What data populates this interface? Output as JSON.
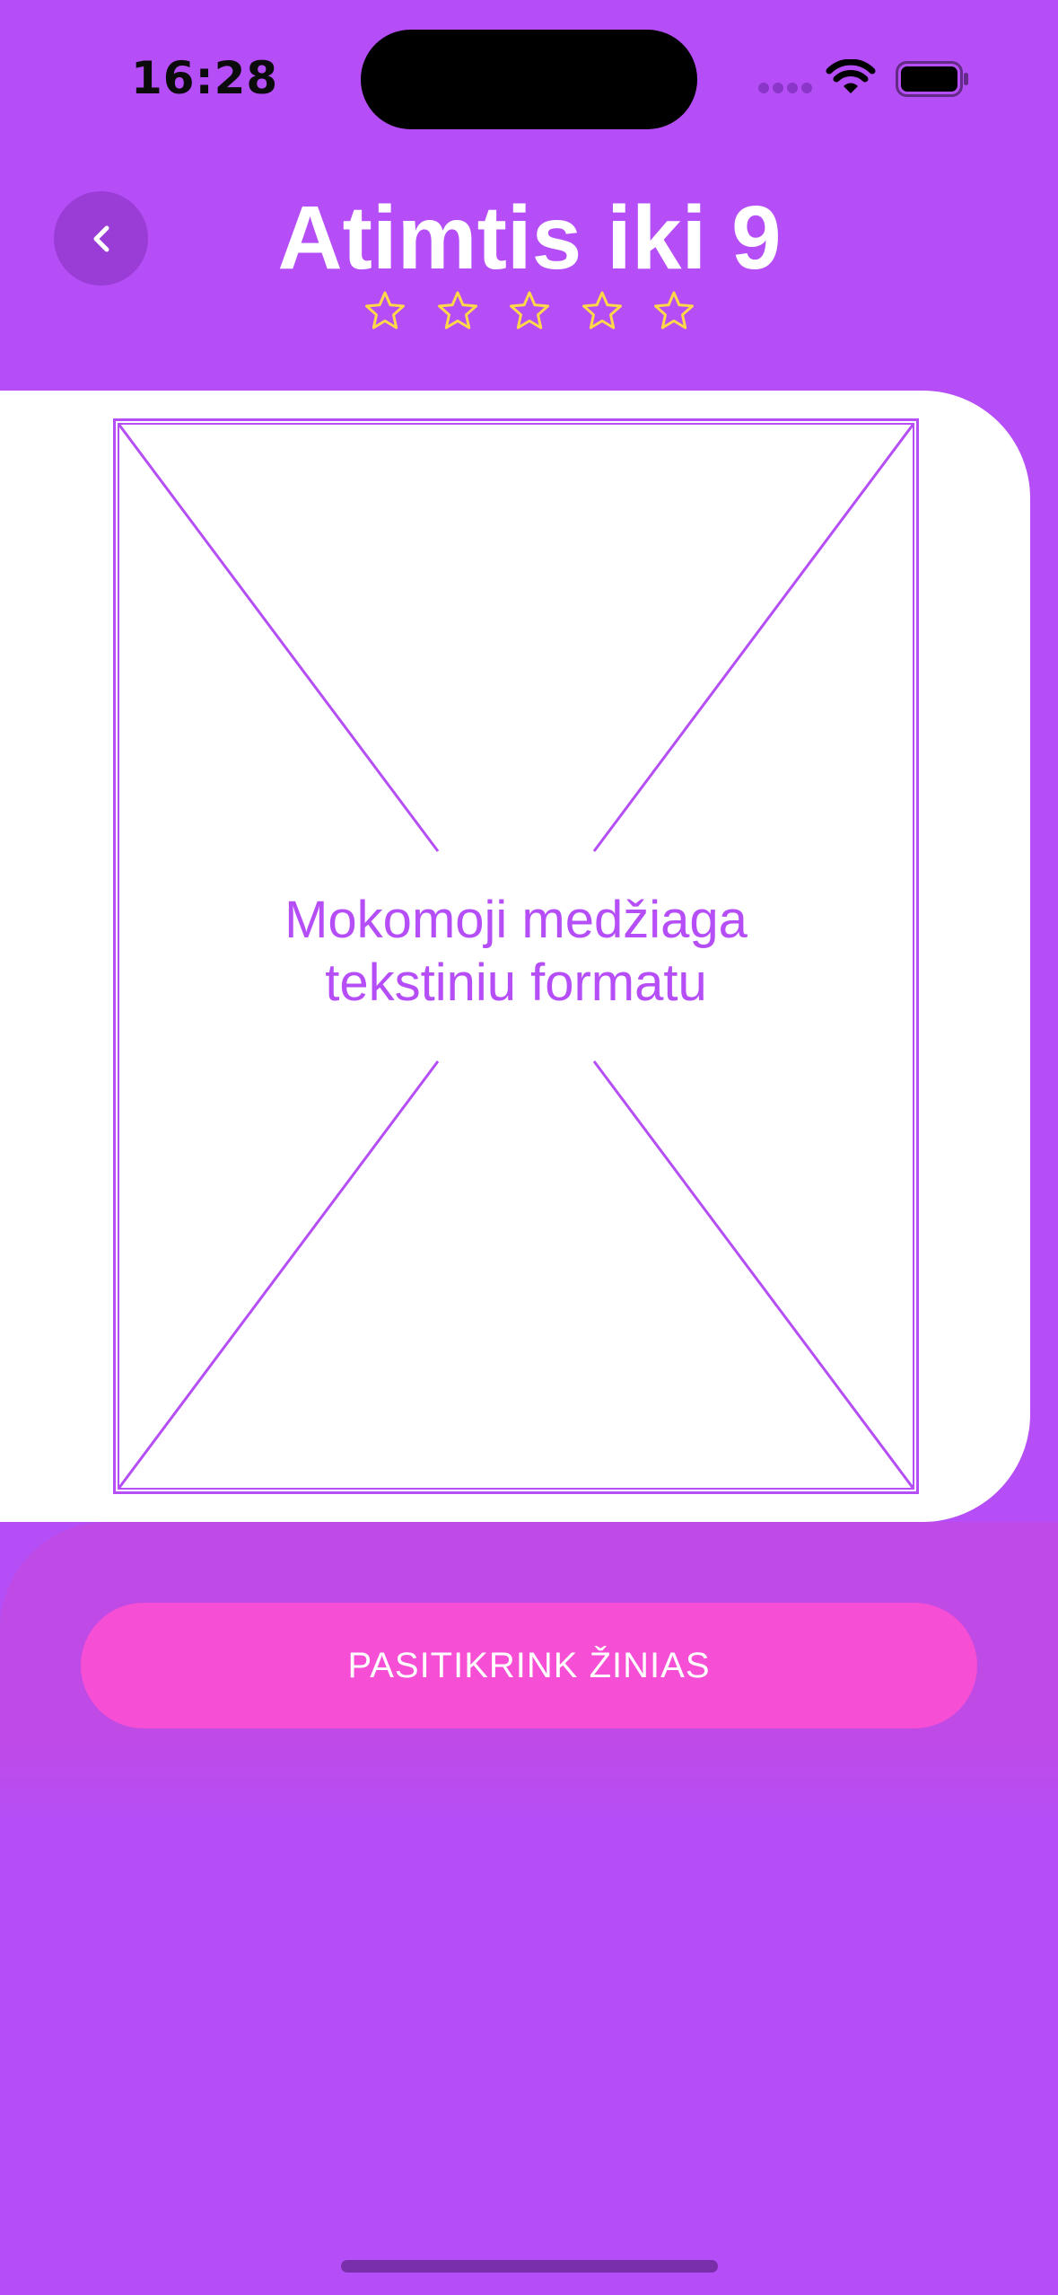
{
  "status_bar": {
    "time": "16:28"
  },
  "header": {
    "title": "Atimtis iki 9",
    "stars_total": 5,
    "stars_filled": 0,
    "back_icon": "chevron-left-icon"
  },
  "content": {
    "placeholder_line1": "Mokomoji medžiaga",
    "placeholder_line2": "tekstiniu formatu"
  },
  "actions": {
    "check_button_label": "PASITIKRINK ŽINIAS"
  },
  "colors": {
    "background": "#b54ef6",
    "button": "#f64ed4",
    "star": "#ffd84a",
    "card": "#ffffff"
  }
}
